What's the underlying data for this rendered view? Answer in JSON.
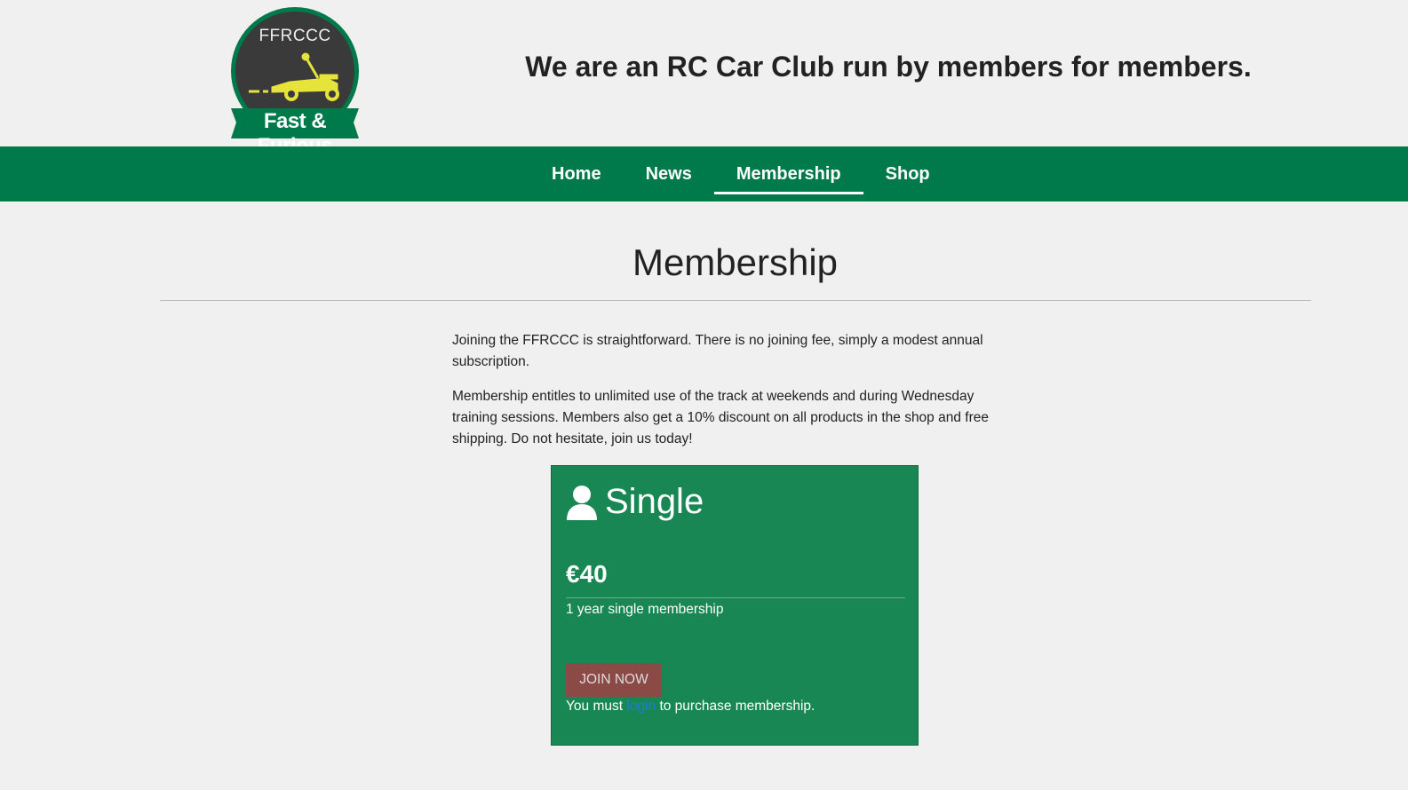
{
  "header": {
    "logo": {
      "top_text": "FFRCCC",
      "banner_text": "Fast & Furious",
      "colors": {
        "circle": "#3a3a3a",
        "ring": "#007a4a",
        "car": "#e6e33a",
        "banner": "#007a4a"
      }
    },
    "tagline": "We are an RC Car Club run by members for members."
  },
  "nav": {
    "items": [
      {
        "label": "Home"
      },
      {
        "label": "News"
      },
      {
        "label": "Membership",
        "active": true
      },
      {
        "label": "Shop"
      }
    ],
    "color": "#007a4a"
  },
  "main": {
    "title": "Membership",
    "paragraphs": [
      "Joining the FFRCCC is straightforward. There is no joining fee, simply a modest annual subscription.",
      "Membership entitles to unlimited use of the track at weekends and during Wednesday training sessions. Members also get a 10% discount on all products in the shop and free shipping. Do not hesitate, join us today!"
    ]
  },
  "plan_card": {
    "icon": "user-icon",
    "title": "Single",
    "price": "€40",
    "description": "1 year single membership",
    "button_label": "JOIN NOW",
    "note_prefix": "You must",
    "note_link": "login",
    "note_suffix": "to purchase membership.",
    "colors": {
      "card": "#198754",
      "button": "#8b4a46",
      "link": "#1e7bd8"
    }
  }
}
